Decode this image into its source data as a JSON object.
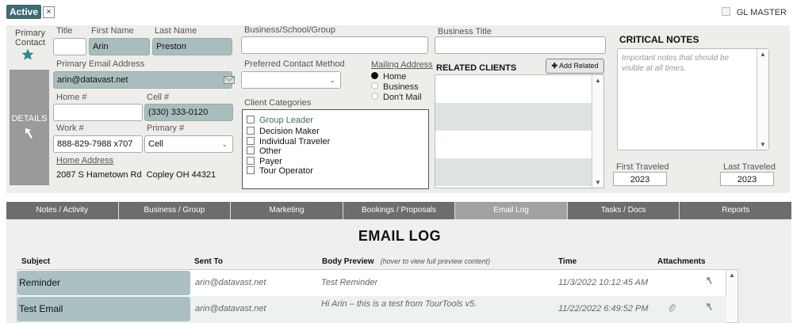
{
  "status": {
    "badge": "Active",
    "close": "×"
  },
  "gl_master": "GL MASTER",
  "contact": {
    "primary_label": "Primary Contact",
    "details_label": "DETAILS",
    "title_label": "Title",
    "title_value": "",
    "first_label": "First Name",
    "first_value": "Arin",
    "last_label": "Last Name",
    "last_value": "Preston",
    "email_label": "Primary Email Address",
    "email_value": "arin@datavast.net",
    "home_label": "Home #",
    "home_value": "",
    "cell_label": "Cell #",
    "cell_value": "(330) 333-0120",
    "work_label": "Work #",
    "work_value": "888-829-7988 x707",
    "primary_num_label": "Primary #",
    "primary_num_value": "Cell",
    "home_address_label": "Home Address",
    "home_address_value": "2087 S Hametown Rd  Copley OH 44321"
  },
  "business": {
    "group_label": "Business/School/Group",
    "group_value": "",
    "title_label": "Business Title",
    "title_value": "",
    "pref_label": "Preferred Contact Method",
    "pref_value": ""
  },
  "mailing": {
    "label": "Mailing Address",
    "options": [
      "Home",
      "Business",
      "Don't Mail"
    ],
    "selected": "Home"
  },
  "categories": {
    "label": "Client Categories",
    "items": [
      "Group Leader",
      "Decision Maker",
      "Individual Traveler",
      "Other",
      "Payer",
      "Tour Operator"
    ]
  },
  "related": {
    "label": "RELATED CLIENTS",
    "add_label": "Add Related",
    "add_icon": "plus-icon"
  },
  "notes": {
    "label": "CRITICAL NOTES",
    "placeholder": "Important notes that should be visible at all times."
  },
  "travel": {
    "first_label": "First Traveled",
    "first_value": "2023",
    "last_label": "Last Traveled",
    "last_value": "2023"
  },
  "tabs": [
    "Notes / Activity",
    "Business / Group",
    "Marketing",
    "Bookings / Proposals",
    "Email Log",
    "Tasks / Docs",
    "Reports"
  ],
  "active_tab": "Email Log",
  "email_log": {
    "title": "EMAIL LOG",
    "headers": {
      "subject": "Subject",
      "sent_to": "Sent To",
      "body": "Body Preview",
      "body_hint": "(hover to view full preview content)",
      "time": "Time",
      "attachments": "Attachments"
    },
    "rows": [
      {
        "subject": "Reminder",
        "sent_to": "arin@datavast.net",
        "body": "Test Reminder",
        "time": "11/3/2022 10:12:45 AM",
        "attachment": false
      },
      {
        "subject": "Test Email",
        "sent_to": "arin@datavast.net",
        "body": "Hi Arin – this is a test from TourTools v5.",
        "time": "11/22/2022 6:49:52 PM",
        "attachment": true
      }
    ]
  },
  "colors": {
    "accent": "#3f6a72",
    "field_teal": "#a9bdbf",
    "tab_bg": "#6d6d6d",
    "tab_active": "#a2a2a2"
  }
}
